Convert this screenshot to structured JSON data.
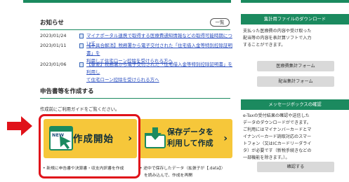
{
  "news": {
    "title": "お知らせ",
    "list_button": "一覧",
    "items": [
      {
        "date": "2023/01/24",
        "lines": [
          "マイナポータル連携で取得する医療費通知情報などの取得可能時期について"
        ]
      },
      {
        "date": "2023/01/11",
        "lines": [
          "【不具合解消】税務署から電子交付された「住宅借入金等特別控除証明書」を",
          "利用して住宅ローン控除を受けられる方へ"
        ]
      },
      {
        "date": "2023/01/06",
        "lines": [
          "【重要】税務署から電子交付された「住宅借入金等特別控除証明書」を利用し",
          "て住宅ローン控除を受けられる方へ"
        ]
      }
    ]
  },
  "create": {
    "title": "申告書等を作成する",
    "note": "作成前にご利用ガイドをご覧ください。",
    "start_card": {
      "badge": "NEW",
      "label": "作成開始",
      "chevron": "›",
      "description": "• 新規に申告書や決算書・収支内訳書を作成"
    },
    "resume_card": {
      "label_line1": "保存データを",
      "label_line2": "利用して作成",
      "chevron": "›",
      "description_line1": "• 途中で保存したデータ（拡張子が【.data】）",
      "description_line2": "を読み込んで、作成を再開"
    }
  },
  "sidebar": {
    "download": {
      "header": "集計用ファイルのダウンロード",
      "text_lines": [
        "支払った医療費の内容や受け取った",
        "配当等の内容を表計算ソフトで入力",
        "することができます。"
      ],
      "buttons": [
        "医療費集計フォーム",
        "配当集計フォーム"
      ]
    },
    "message": {
      "header": "メッセージボックスの確認",
      "text_lines": [
        "e-Taxの受付結果の確認や送信した",
        "データのダウンロードができます。",
        "ご利用にはマイナンバーカードとマ",
        "イナンバーカード読取対応のスマー",
        "トフォン（又はICカードリーダライ",
        "タ）が必要です（新税手続きなどの",
        "一部機能を除きます。）。"
      ],
      "button": "確認する"
    }
  },
  "colors": {
    "brand_green": "#1b8a5f",
    "card_yellow": "#f6c73a",
    "highlight_red": "#e0121a",
    "link_blue": "#2b4fbf"
  }
}
